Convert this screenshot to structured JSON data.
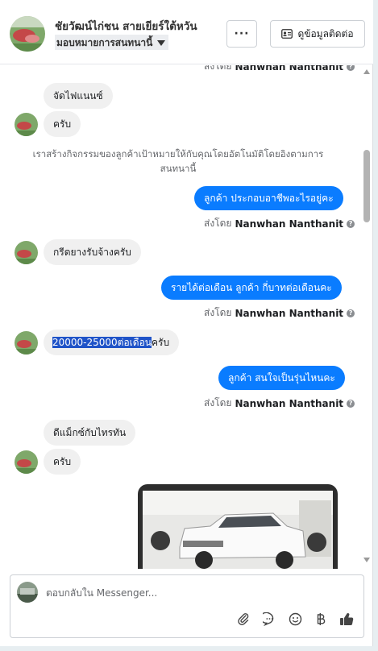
{
  "header": {
    "name": "ชัยวัฒน์ไก่ชน สายเยียร์ใต้หวัน",
    "assign_label": "มอบหมายการสนทนานี้",
    "more_label": "···",
    "contact_label": "ดูข้อมูลติดต่อ"
  },
  "messages": {
    "top_sender": {
      "prefix": "ส่งโดย",
      "name": "Nanwhan Nanthanit"
    },
    "in_1": "จัดไฟแนนซ์",
    "in_2": "ครับ",
    "system": "เราสร้างกิจกรรมของลูกค้าเป้าหมายให้กับคุณโดยอัตโนมัติโดยอิงตามการสนทนานี้",
    "out_1": "ลูกค้า ประกอบอาชีพอะไรอยู่คะ",
    "sender_1": {
      "prefix": "ส่งโดย",
      "name": "Nanwhan Nanthanit"
    },
    "in_3": "กรีดยางรับจ้างครับ",
    "out_2": "รายได้ต่อเดือน ลูกค้า กี่บาทต่อเดือนคะ",
    "sender_2": {
      "prefix": "ส่งโดย",
      "name": "Nanwhan Nanthanit"
    },
    "in_4_highlight": "20000-25000ต่อเดือน",
    "in_4_rest": "ครับ",
    "out_3": "ลูกค้า สนใจเป็นรุ่นไหนคะ",
    "sender_3": {
      "prefix": "ส่งโดย",
      "name": "Nanwhan Nanthanit"
    },
    "in_5": "ดีแม็กซ์กับไทรทัน",
    "in_6": "ครับ"
  },
  "composer": {
    "placeholder": "ตอบกลับใน Messenger...",
    "icons": [
      "paperclip-icon",
      "chat-bubble-icon",
      "emoji-icon",
      "baht-icon",
      "thumbs-up-icon"
    ]
  },
  "colors": {
    "outgoing_bubble": "#0a7cff",
    "incoming_bubble": "#f0f0f0",
    "highlight": "#1f53c8"
  }
}
